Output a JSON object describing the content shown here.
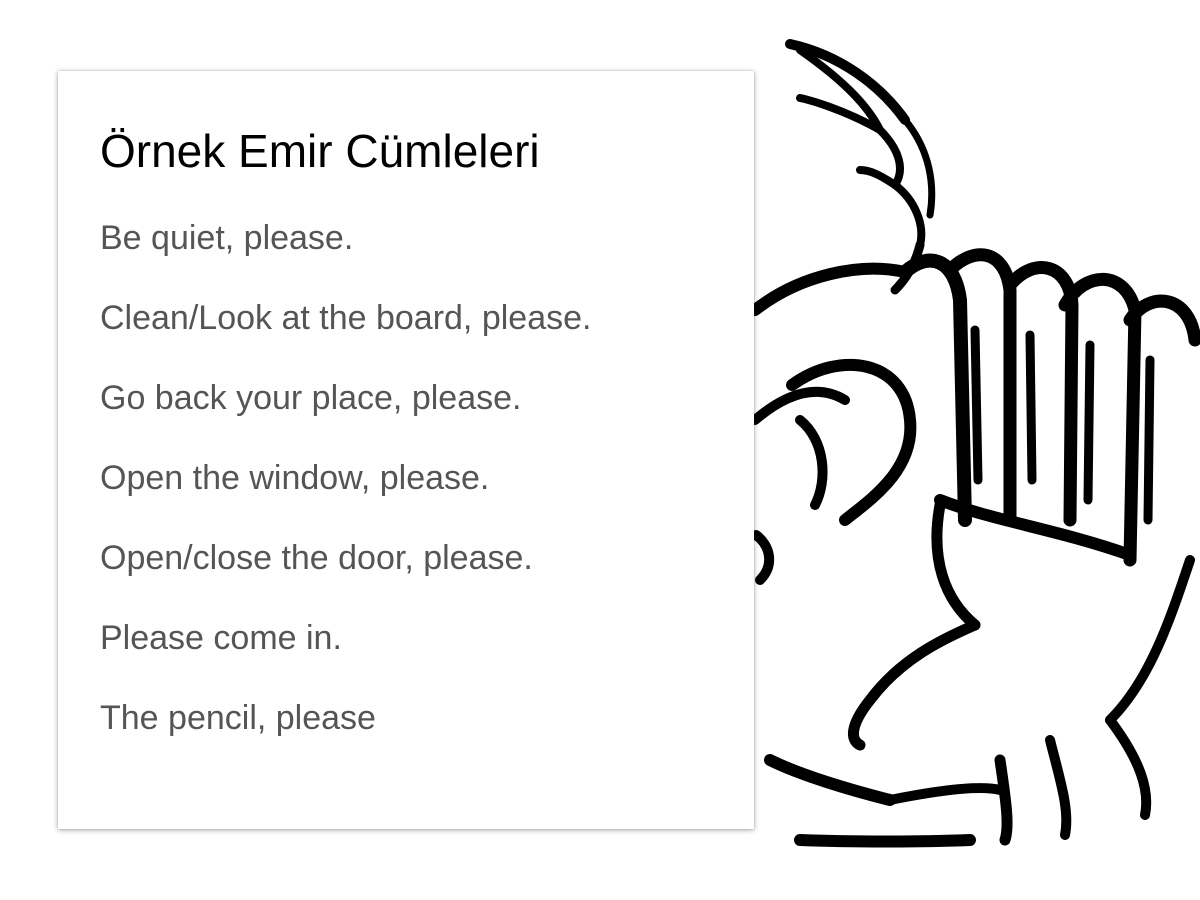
{
  "slide": {
    "title": "Örnek Emir Cümleleri",
    "lines": [
      "Be quiet, please.",
      "Clean/Look at the board, please.",
      "Go back your place, please.",
      "Open the window, please.",
      "Open/close the door, please.",
      "Please come in.",
      "The pencil, please"
    ]
  },
  "illustration": {
    "icon": "cartoon-hand-behind-ear-icon"
  },
  "colors": {
    "title_text": "#000000",
    "body_text": "#555555",
    "background": "#ffffff",
    "drawing_stroke": "#000000"
  }
}
